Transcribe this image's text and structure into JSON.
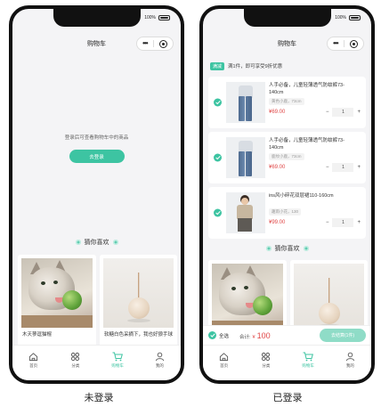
{
  "status": {
    "battery_text": "100%"
  },
  "left": {
    "title": "购物车",
    "login_hint": "登录后可查看购物车中的商品",
    "login_button": "去登录",
    "guess_title": "猜你喜欢",
    "recommendations": [
      {
        "caption": "木天蓼逗猫棍"
      },
      {
        "caption": "软糖白色采摘下，我也好狼手球"
      }
    ],
    "caption_label": "未登录"
  },
  "right": {
    "title": "购物车",
    "promo_tag": "满减",
    "promo_text": "满1件，即可享受9折优惠",
    "items": [
      {
        "title": "人手必备，儿童轻薄透气防蚊裤73-140cm",
        "sku": "黄色小鹿，73cm",
        "price": "¥69.00",
        "qty": "1"
      },
      {
        "title": "人手必备，儿童轻薄透气防蚊裤73-140cm",
        "sku": "鹿纹小鹿，73cm",
        "price": "¥69.00",
        "qty": "1"
      },
      {
        "title": "ins风小碎花双层裙110-160cm",
        "sku": "趣雨小花，130",
        "price": "¥99.00",
        "qty": "1"
      }
    ],
    "guess_title": "猜你喜欢",
    "select_all": "全选",
    "total_label": "合计:",
    "total_currency": "¥",
    "total_amount": "100",
    "checkout_button": "去结算(1件)",
    "caption_label": "已登录"
  },
  "tabbar": [
    {
      "label": "首页",
      "icon": "home-icon"
    },
    {
      "label": "分类",
      "icon": "category-icon"
    },
    {
      "label": "购物车",
      "icon": "cart-icon"
    },
    {
      "label": "我的",
      "icon": "user-icon"
    }
  ],
  "colors": {
    "accent": "#3dc4a2",
    "price": "#e04848",
    "checkout_button": "#8fdcc7"
  }
}
